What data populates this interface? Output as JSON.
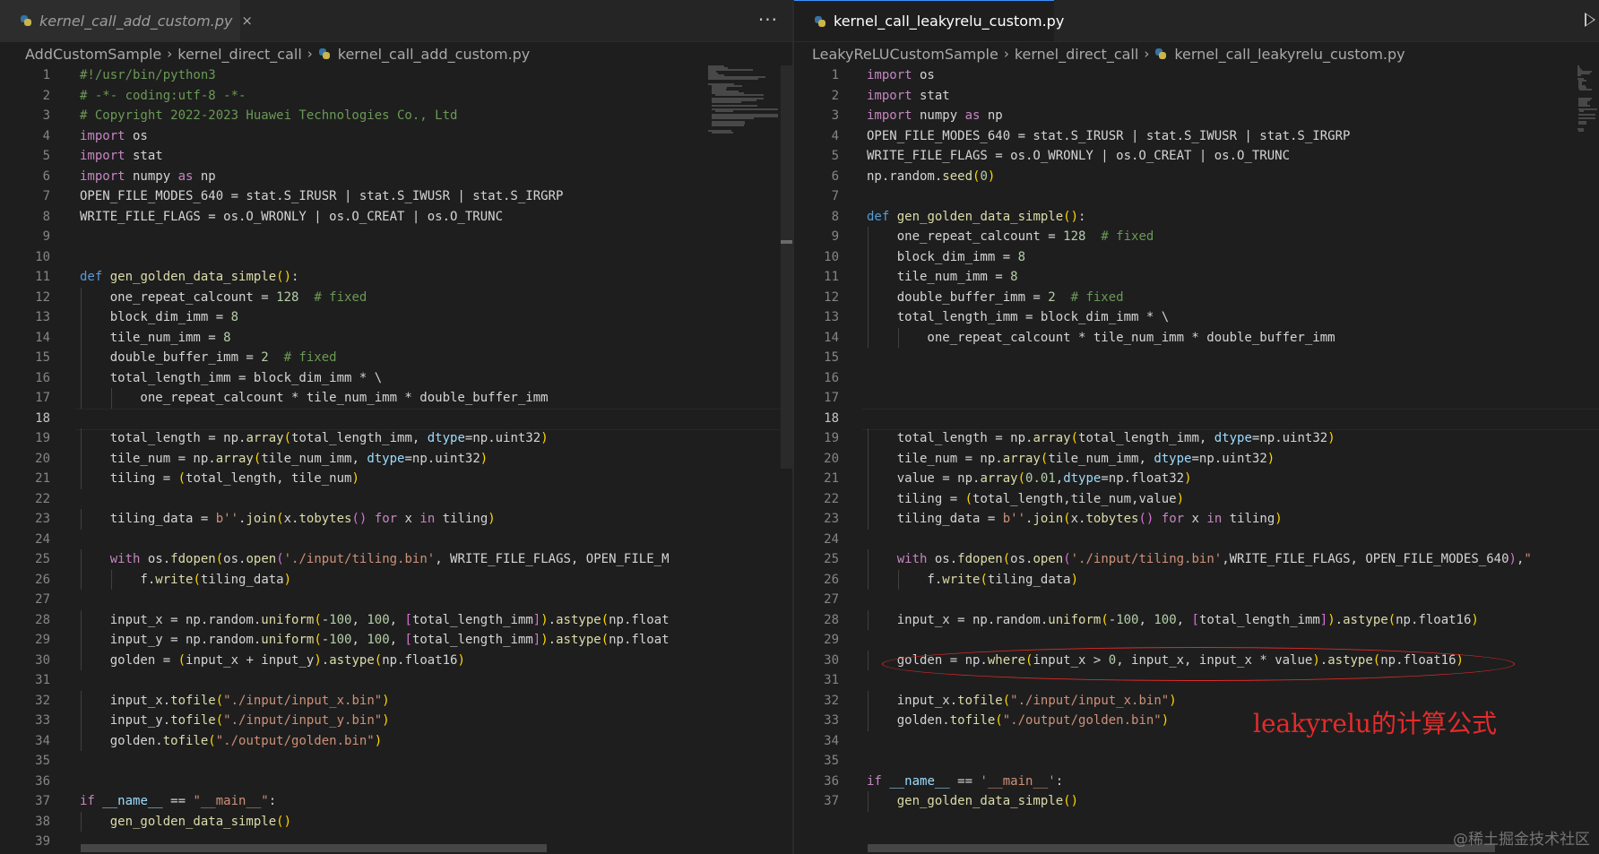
{
  "left": {
    "tab": {
      "filename": "kernel_call_add_custom.py",
      "close": "×"
    },
    "more": "···",
    "breadcrumb": [
      "AddCustomSample",
      "kernel_direct_call",
      "kernel_call_add_custom.py"
    ],
    "current_line": 18,
    "lines": [
      {
        "n": "1",
        "c": "#!/usr/bin/python3"
      },
      {
        "n": "2",
        "c": "# -*- coding:utf-8 -*-"
      },
      {
        "n": "3",
        "c": "# Copyright 2022-2023 Huawei Technologies Co., Ltd"
      },
      {
        "n": "4",
        "c": "import os"
      },
      {
        "n": "5",
        "c": "import stat"
      },
      {
        "n": "6",
        "c": "import numpy as np"
      },
      {
        "n": "7",
        "c": "OPEN_FILE_MODES_640 = stat.S_IRUSR | stat.S_IWUSR | stat.S_IRGRP"
      },
      {
        "n": "8",
        "c": "WRITE_FILE_FLAGS = os.O_WRONLY | os.O_CREAT | os.O_TRUNC"
      },
      {
        "n": "9",
        "c": ""
      },
      {
        "n": "10",
        "c": ""
      },
      {
        "n": "11",
        "c": "def gen_golden_data_simple():"
      },
      {
        "n": "12",
        "c": "    one_repeat_calcount = 128  # fixed"
      },
      {
        "n": "13",
        "c": "    block_dim_imm = 8"
      },
      {
        "n": "14",
        "c": "    tile_num_imm = 8"
      },
      {
        "n": "15",
        "c": "    double_buffer_imm = 2  # fixed"
      },
      {
        "n": "16",
        "c": "    total_length_imm = block_dim_imm * \\"
      },
      {
        "n": "17",
        "c": "        one_repeat_calcount * tile_num_imm * double_buffer_imm"
      },
      {
        "n": "18",
        "c": ""
      },
      {
        "n": "19",
        "c": "    total_length = np.array(total_length_imm, dtype=np.uint32)"
      },
      {
        "n": "20",
        "c": "    tile_num = np.array(tile_num_imm, dtype=np.uint32)"
      },
      {
        "n": "21",
        "c": "    tiling = (total_length, tile_num)"
      },
      {
        "n": "22",
        "c": ""
      },
      {
        "n": "23",
        "c": "    tiling_data = b''.join(x.tobytes() for x in tiling)"
      },
      {
        "n": "24",
        "c": ""
      },
      {
        "n": "25",
        "c": "    with os.fdopen(os.open('./input/tiling.bin', WRITE_FILE_FLAGS, OPEN_FILE_M"
      },
      {
        "n": "26",
        "c": "        f.write(tiling_data)"
      },
      {
        "n": "27",
        "c": ""
      },
      {
        "n": "28",
        "c": "    input_x = np.random.uniform(-100, 100, [total_length_imm]).astype(np.float"
      },
      {
        "n": "29",
        "c": "    input_y = np.random.uniform(-100, 100, [total_length_imm]).astype(np.float"
      },
      {
        "n": "30",
        "c": "    golden = (input_x + input_y).astype(np.float16)"
      },
      {
        "n": "31",
        "c": ""
      },
      {
        "n": "32",
        "c": "    input_x.tofile(\"./input/input_x.bin\")"
      },
      {
        "n": "33",
        "c": "    input_y.tofile(\"./input/input_y.bin\")"
      },
      {
        "n": "34",
        "c": "    golden.tofile(\"./output/golden.bin\")"
      },
      {
        "n": "35",
        "c": ""
      },
      {
        "n": "36",
        "c": ""
      },
      {
        "n": "37",
        "c": "if __name__ == \"__main__\":"
      },
      {
        "n": "38",
        "c": "    gen_golden_data_simple()"
      },
      {
        "n": "39",
        "c": ""
      }
    ]
  },
  "right": {
    "tab": {
      "filename": "kernel_call_leakyrelu_custom.py"
    },
    "breadcrumb": [
      "LeakyReLUCustomSample",
      "kernel_direct_call",
      "kernel_call_leakyrelu_custom.py"
    ],
    "current_line": 18,
    "lines": [
      {
        "n": "1",
        "c": "import os"
      },
      {
        "n": "2",
        "c": "import stat"
      },
      {
        "n": "3",
        "c": "import numpy as np"
      },
      {
        "n": "4",
        "c": "OPEN_FILE_MODES_640 = stat.S_IRUSR | stat.S_IWUSR | stat.S_IRGRP"
      },
      {
        "n": "5",
        "c": "WRITE_FILE_FLAGS = os.O_WRONLY | os.O_CREAT | os.O_TRUNC"
      },
      {
        "n": "6",
        "c": "np.random.seed(0)"
      },
      {
        "n": "7",
        "c": ""
      },
      {
        "n": "8",
        "c": "def gen_golden_data_simple():"
      },
      {
        "n": "9",
        "c": "    one_repeat_calcount = 128  # fixed"
      },
      {
        "n": "10",
        "c": "    block_dim_imm = 8"
      },
      {
        "n": "11",
        "c": "    tile_num_imm = 8"
      },
      {
        "n": "12",
        "c": "    double_buffer_imm = 2  # fixed"
      },
      {
        "n": "13",
        "c": "    total_length_imm = block_dim_imm * \\"
      },
      {
        "n": "14",
        "c": "        one_repeat_calcount * tile_num_imm * double_buffer_imm"
      },
      {
        "n": "15",
        "c": ""
      },
      {
        "n": "16",
        "c": ""
      },
      {
        "n": "17",
        "c": ""
      },
      {
        "n": "18",
        "c": ""
      },
      {
        "n": "19",
        "c": "    total_length = np.array(total_length_imm, dtype=np.uint32)"
      },
      {
        "n": "20",
        "c": "    tile_num = np.array(tile_num_imm, dtype=np.uint32)"
      },
      {
        "n": "21",
        "c": "    value = np.array(0.01,dtype=np.float32)"
      },
      {
        "n": "22",
        "c": "    tiling = (total_length,tile_num,value)"
      },
      {
        "n": "23",
        "c": "    tiling_data = b''.join(x.tobytes() for x in tiling)"
      },
      {
        "n": "24",
        "c": ""
      },
      {
        "n": "25",
        "c": "    with os.fdopen(os.open('./input/tiling.bin',WRITE_FILE_FLAGS, OPEN_FILE_MODES_640),\""
      },
      {
        "n": "26",
        "c": "        f.write(tiling_data)"
      },
      {
        "n": "27",
        "c": ""
      },
      {
        "n": "28",
        "c": "    input_x = np.random.uniform(-100, 100, [total_length_imm]).astype(np.float16)"
      },
      {
        "n": "29",
        "c": ""
      },
      {
        "n": "30",
        "c": "    golden = np.where(input_x > 0, input_x, input_x * value).astype(np.float16)"
      },
      {
        "n": "31",
        "c": ""
      },
      {
        "n": "32",
        "c": "    input_x.tofile(\"./input/input_x.bin\")"
      },
      {
        "n": "33",
        "c": "    golden.tofile(\"./output/golden.bin\")"
      },
      {
        "n": "34",
        "c": ""
      },
      {
        "n": "35",
        "c": ""
      },
      {
        "n": "36",
        "c": "if __name__ == '__main__':"
      },
      {
        "n": "37",
        "c": "    gen_golden_data_simple()"
      }
    ]
  },
  "annotation": "leakyrelu的计算公式",
  "watermark": "@稀土掘金技术社区",
  "colors": {
    "accent": "#3794ff",
    "annotation": "#e42b2b",
    "background": "#1e1e1e"
  }
}
